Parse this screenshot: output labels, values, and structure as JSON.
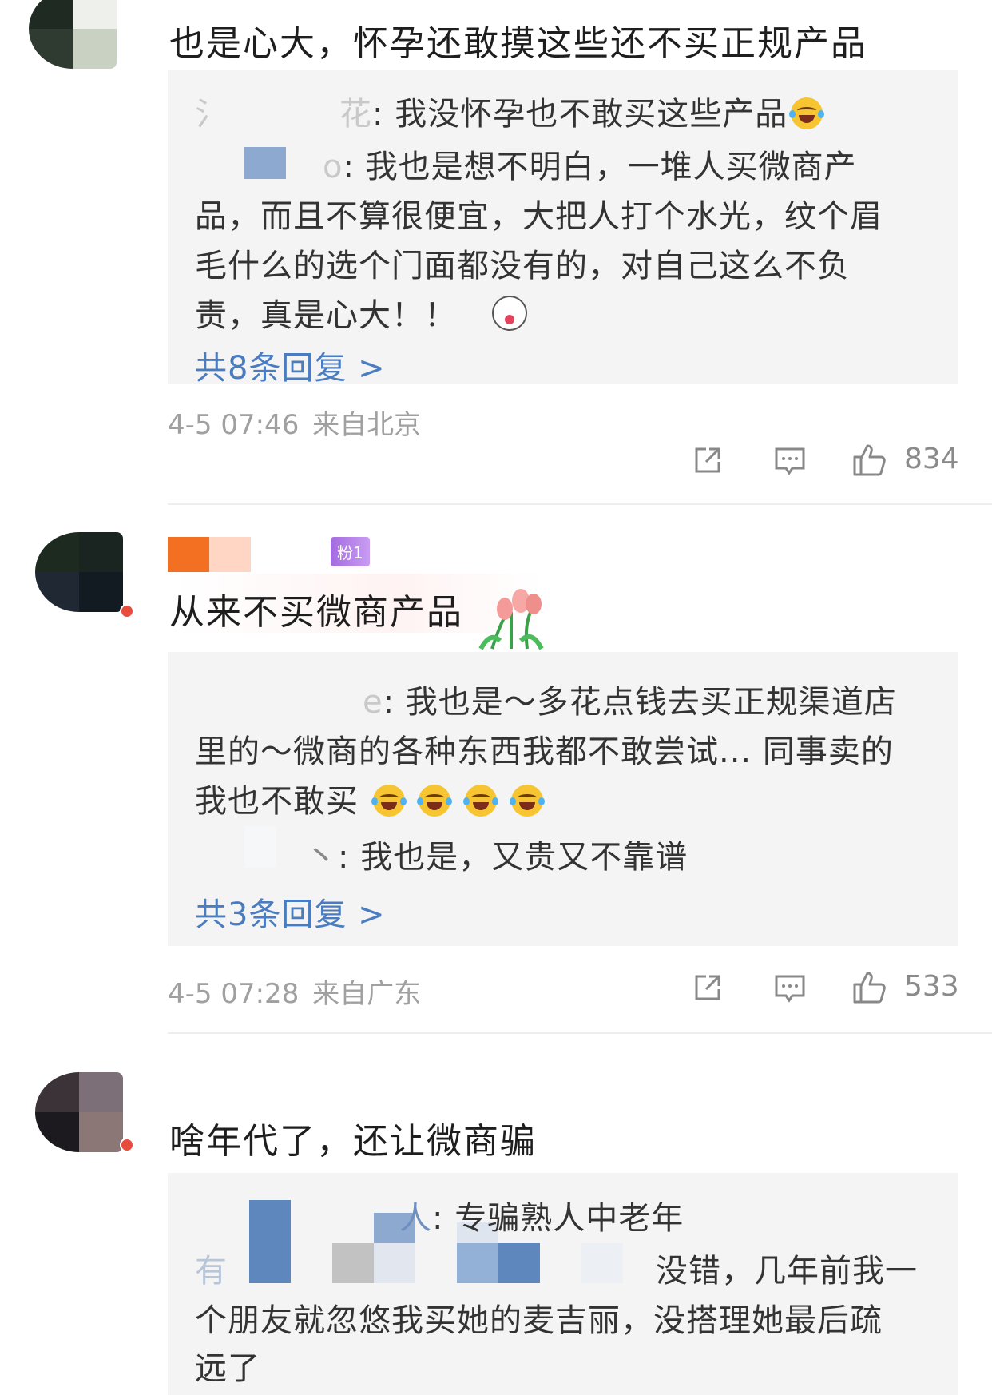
{
  "comments": [
    {
      "text": "也是心大，怀孕还敢摸这些还不买正规产品",
      "replies": [
        "我没怀孕也不敢买这些产品",
        "我也是想不明白，一堆人买微商产",
        "品，而且不算很便宜，大把人打个水光，纹个眉",
        "毛什么的选个门面都没有的，对自己这么不负",
        "责，真是心大！！"
      ],
      "reply_name_fragments": [
        "氵",
        "花",
        "o"
      ],
      "more_replies": "共8条回复 >",
      "time": "4-5 07:46",
      "location": "来自北京",
      "likes": "834",
      "emoji_icons": [
        "laughing-crying-emoji",
        "husky-emoji"
      ]
    },
    {
      "badge": "粉1",
      "text": "从来不买微商产品",
      "replies": [
        "我也是～多花点钱去买正规渠道店",
        "里的～微商的各种东西我都不敢尝试... 同事卖的",
        "我也不敢买",
        "我也是，又贵又不靠谱"
      ],
      "reply_name_fragments": [
        "e",
        "丶"
      ],
      "more_replies": "共3条回复 >",
      "time": "4-5 07:28",
      "location": "来自广东",
      "likes": "533",
      "emoji_icons": [
        "tulip-sticker",
        "laughing-crying-emoji"
      ]
    },
    {
      "text": "啥年代了，还让微商骗",
      "replies": [
        "专骗熟人中老年",
        "没错，几年前我一",
        "个朋友就忽悠我买她的麦吉丽，没搭理她最后疏",
        "远了"
      ],
      "reply_name_fragments": [
        "人",
        "有"
      ]
    }
  ],
  "colors": {
    "reply_bg": "#f4f4f4",
    "link": "#4a7dc0",
    "meta": "#a0a0a0",
    "badge": "#a36be0"
  },
  "icons": [
    "share-icon",
    "comment-icon",
    "like-icon"
  ]
}
